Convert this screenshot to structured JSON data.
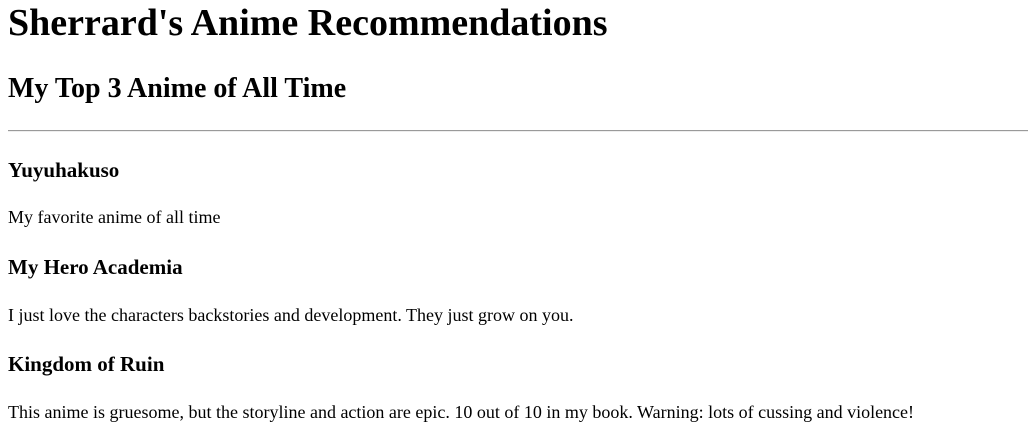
{
  "page": {
    "title": "Sherrard's Anime Recommendations",
    "subtitle": "My Top 3 Anime of All Time"
  },
  "anime": [
    {
      "title": "Yuyuhakuso",
      "description": "My favorite anime of all time"
    },
    {
      "title": "My Hero Academia",
      "description": "I just love the characters backstories and development. They just grow on you."
    },
    {
      "title": "Kingdom of Ruin",
      "description": "This anime is gruesome, but the storyline and action are epic. 10 out of 10 in my book. Warning: lots of cussing and violence!"
    }
  ]
}
